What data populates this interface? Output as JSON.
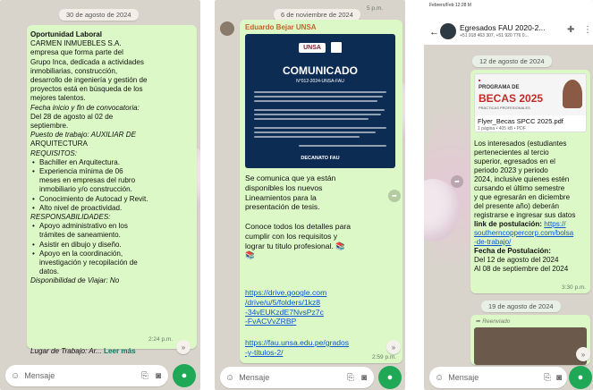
{
  "panel1": {
    "date_chip": "30 de agosto de 2024",
    "lines": [
      {
        "t": "Oportunidad Laboral",
        "s": "b"
      },
      {
        "t": "CARMEN INMUEBLES S.A.",
        "s": ""
      },
      {
        "t": "empresa que forma parte del",
        "s": ""
      },
      {
        "t": "Grupo Inca, dedicada a actividades",
        "s": ""
      },
      {
        "t": "inmobiliarias, construcción,",
        "s": ""
      },
      {
        "t": "desarrollo de ingeniería y gestión de",
        "s": ""
      },
      {
        "t": "proyectos está en búsqueda de los",
        "s": ""
      },
      {
        "t": "mejores talentos.",
        "s": ""
      },
      {
        "t": "Fecha inicio y fin de convocatoria:",
        "s": "i"
      },
      {
        "t": "Del 28 de agosto al 02 de",
        "s": ""
      },
      {
        "t": "septiembre.",
        "s": ""
      },
      {
        "t": "Puesto de trabajo: AUXILIAR DE",
        "s": "ip"
      },
      {
        "t": "ARQUITECTURA",
        "s": ""
      },
      {
        "t": "REQUISITOS:",
        "s": "i"
      },
      {
        "t": "Bachiller en Arquitectura.",
        "s": "bul"
      },
      {
        "t": "Experiencia mínima de 06",
        "s": "bul"
      },
      {
        "t": "meses en empresas del rubro",
        "s": "cont"
      },
      {
        "t": "inmobiliario y/o construcción.",
        "s": "cont"
      },
      {
        "t": "Conocimiento de Autocad y Revit.",
        "s": "bul"
      },
      {
        "t": "Alto nivel de proactividad.",
        "s": "bul"
      },
      {
        "t": "RESPONSABILIDADES:",
        "s": "i"
      },
      {
        "t": "Apoyo administrativo en los",
        "s": "bul"
      },
      {
        "t": "trámites de saneamiento.",
        "s": "cont"
      },
      {
        "t": "Asistir en dibujo y diseño.",
        "s": "bul"
      },
      {
        "t": "Apoyo en la coordinación,",
        "s": "bul"
      },
      {
        "t": "investigación y recopilación de",
        "s": "cont"
      },
      {
        "t": "datos.",
        "s": "cont"
      },
      {
        "t": "Disponibilidad de Viajar: No",
        "s": "ip"
      }
    ],
    "last_line_prefix": "Lugar de Trabajo: Ar...",
    "read_more": "Leer más",
    "time": "2:24 p.m.",
    "input_placeholder": "Mensaje"
  },
  "panel2": {
    "date_chip": "6 de noviembre de 2024",
    "time_top": "5 p.m.",
    "sender": "Eduardo Bejar UNSA",
    "doc": {
      "unsa_logo": "UNSA",
      "title": "COMUNICADO",
      "number": "N°012-2024-UNSA-FAU",
      "footer": "DECANATO FAU"
    },
    "lines": [
      "Se comunica que ya están",
      "disponibles los nuevos",
      "Lineamientos para la",
      "presentación de tesis.",
      "",
      "Conoce todos los detalles para",
      "cumplir con los requisitos y",
      "lograr tu titulo profesional. 📚",
      "📚"
    ],
    "link1": [
      "https://drive.google.com",
      "/drive/u/5/folders/1kz8",
      "-34vEUKzdE7NvsPz7c",
      "-FvACVvZRBP"
    ],
    "link2": [
      "https://fau.unsa.edu.pe/grados",
      "-y-titulos-2/"
    ],
    "time": "2:59 p.m.",
    "input_placeholder": "Mensaje"
  },
  "panel3": {
    "status_time": "Febrero/Feb 12:28 M",
    "group_name": "Egresados FAU 2020-2...",
    "group_members": "+51 918 463 307, +51 920 776 0...",
    "date_chip1": "12 de agosto de 2024",
    "flyer_header": "PROGRAMA DE",
    "flyer_title": "BECAS 2025",
    "flyer_sub": "PRÁCTICAS PROFESIONALES",
    "file_name": "Flyer_Becas SPCC 2025.pdf",
    "file_meta": "1 página • 405 kB • PDF",
    "lines": [
      {
        "t": "Los interesados (estudiantes",
        "s": ""
      },
      {
        "t": "pertenecientes al tercio",
        "s": ""
      },
      {
        "t": "superior, egresados en el",
        "s": ""
      },
      {
        "t": "periodo 2023 y periodo",
        "s": ""
      },
      {
        "t": "2024, inclusive quienes estén",
        "s": ""
      },
      {
        "t": "cursando el último semestre",
        "s": ""
      },
      {
        "t": "y que egresarán en diciembre",
        "s": ""
      },
      {
        "t": "del presente año) deberán",
        "s": ""
      },
      {
        "t": "registrarse e ingresar sus datos",
        "s": ""
      }
    ],
    "link_label": "link de postulación: ",
    "link_lines": [
      "https://",
      "southerncoppercorp.com/bolsa",
      "-de-trabajo/"
    ],
    "fecha_label": "Fecha de Postulación:",
    "fecha_lines": [
      "Del  12 de agosto del 2024",
      "Al  08 de septiembre del 2024"
    ],
    "time": "3:30 p.m.",
    "date_chip2": "19 de agosto de 2024",
    "forwarded": "Reenviado",
    "input_placeholder": "Mensaje"
  },
  "colors": {
    "bubble_green": "#dcf8c6",
    "link": "#0b57d0",
    "mic_green": "#1fa855",
    "sender_orange": "#c8602d",
    "doc_navy": "#0d2c54"
  }
}
